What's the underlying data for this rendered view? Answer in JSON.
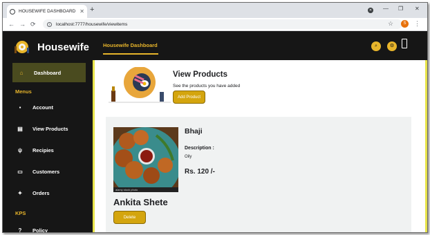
{
  "browser": {
    "tab_title": "HOUSEWIFE DASHBOARD",
    "tab_close": "✕",
    "new_tab": "+",
    "url": "localhost:7777/housewife/viewitems",
    "profile_initial": "S"
  },
  "sidebar": {
    "brand": "Housewife",
    "active_item": {
      "label": "Dashboard",
      "icon": "home-icon"
    },
    "sections": [
      {
        "heading": "Menus",
        "items": [
          {
            "label": "Account",
            "icon": "lock-icon"
          },
          {
            "label": "View Products",
            "icon": "document-icon"
          },
          {
            "label": "Recipies",
            "icon": "utensils-icon"
          },
          {
            "label": "Customers",
            "icon": "folder-icon"
          },
          {
            "label": "Orders",
            "icon": "handshake-icon"
          }
        ]
      },
      {
        "heading": "KPS",
        "items": [
          {
            "label": "Policy",
            "icon": "question-icon"
          }
        ]
      }
    ]
  },
  "topbar": {
    "title": "Housewife Dashboard",
    "icons": [
      "search-icon",
      "settings-icon",
      "mobile-icon"
    ]
  },
  "header": {
    "title": "View Products",
    "subtitle": "See the products you have added",
    "add_button": "Add Product"
  },
  "product": {
    "name": "Bhaji",
    "description_label": "Description :",
    "description": "Oily",
    "price": "Rs. 120 /-",
    "owner": "Ankita Shete",
    "image_caption": "alamy stock photo",
    "delete_button": "Delete"
  },
  "colors": {
    "accent": "#e8b52b",
    "sidebar_bg": "#161616",
    "active_bg": "#4a4b1f",
    "border_accent": "#e8e44a",
    "button": "#d4a50e",
    "card_bg": "#f0f2f2"
  }
}
